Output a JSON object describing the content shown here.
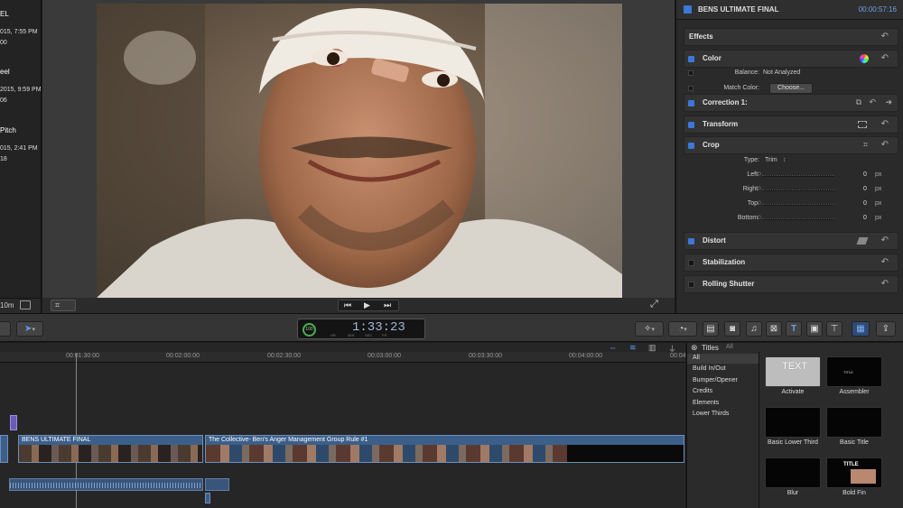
{
  "browser": {
    "events": [
      {
        "title": "EL",
        "date": "015, 7:55 PM",
        "count": "00"
      },
      {
        "title": "eel",
        "date": "2015, 9:59 PM",
        "count": "06"
      },
      {
        "title": "Pitch",
        "date": "015, 2:41 PM",
        "count": "18"
      }
    ],
    "footer_label": "10m"
  },
  "inspector": {
    "project_title": "BENS ULTIMATE FINAL",
    "duration": "00:00:57:16",
    "effects_label": "Effects",
    "color_label": "Color",
    "balance_label": "Balance:",
    "balance_value": "Not Analyzed",
    "match_color_label": "Match Color:",
    "choose_button": "Choose...",
    "correction_label": "Correction 1:",
    "transform_label": "Transform",
    "crop_label": "Crop",
    "type_label": "Type:",
    "type_value": "Trim",
    "crop_params": [
      {
        "label": "Left:",
        "value": "0",
        "unit": "px"
      },
      {
        "label": "Right:",
        "value": "0",
        "unit": "px"
      },
      {
        "label": "Top:",
        "value": "0",
        "unit": "px"
      },
      {
        "label": "Bottom:",
        "value": "0",
        "unit": "px"
      }
    ],
    "distort_label": "Distort",
    "stabilization_label": "Stabilization",
    "rolling_shutter_label": "Rolling Shutter"
  },
  "toolbar": {
    "zoom": "100",
    "timecode": "1:33:23",
    "tc_units": [
      "HR",
      "MIN",
      "SEC",
      "FR"
    ]
  },
  "timeline": {
    "ticks": [
      "00:01:30:00",
      "00:02:00:00",
      "00:02:30:00",
      "00:03:00:00",
      "00:03:30:00",
      "00:04:00:00",
      "00:04:30:00"
    ],
    "clips": [
      "BENS ULTIMATE FINAL",
      "The Collective- Ben's Anger Management Group Rule #1"
    ]
  },
  "titles": {
    "header": "Titles",
    "filter": "All",
    "categories": [
      "All",
      "Build In/Out",
      "Bumper/Opener",
      "Credits",
      "Elements",
      "Lower Thirds"
    ],
    "items": [
      "Activate",
      "Assembler",
      "Basic Lower Third",
      "Basic Title",
      "Blur",
      "Bold Fin"
    ],
    "activate_thumb_text": "TEXT",
    "assembler_thumb_text": "TITLE",
    "boldfin_thumb_text": "TITLE"
  },
  "colors": {
    "accent": "#3b78d8",
    "timecode": "#9fb7d8",
    "clip": "#3c5f8a"
  }
}
